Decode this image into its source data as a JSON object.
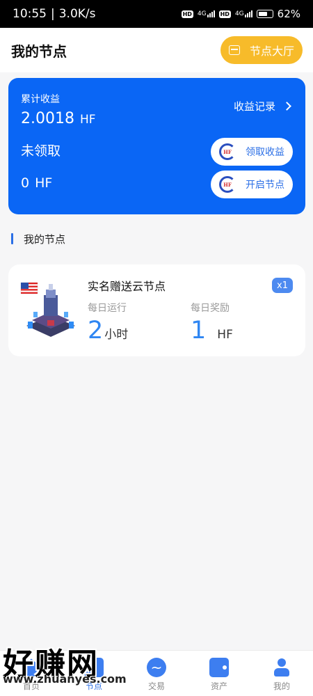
{
  "status_bar": {
    "time": "10:55",
    "speed": "3.0K/s",
    "hd1": "HD",
    "net1": "4G",
    "hd2": "HD",
    "net2": "4G",
    "battery": "62%"
  },
  "header": {
    "title": "我的节点",
    "hall_button": "节点大厅",
    "hall_icon": "store-icon"
  },
  "earnings": {
    "total_label": "累计收益",
    "total_value": "2.0018",
    "total_unit": "HF",
    "record_link": "收益记录",
    "unclaimed_label": "未领取",
    "unclaimed_value": "0",
    "unclaimed_unit": "HF",
    "claim_button": "领取收益",
    "open_node_button": "开启节点",
    "logo_text": "HF"
  },
  "section": {
    "title": "我的节点"
  },
  "node_card": {
    "name": "实名赠送云节点",
    "count_badge": "x1",
    "daily_run_label": "每日运行",
    "daily_run_value": "2",
    "daily_run_unit": "小时",
    "daily_reward_label": "每日奖励",
    "daily_reward_value": "1",
    "daily_reward_unit": "HF"
  },
  "tabs": [
    {
      "label": "首页",
      "icon": "home-icon"
    },
    {
      "label": "节点",
      "icon": "node-icon"
    },
    {
      "label": "交易",
      "icon": "trade-icon"
    },
    {
      "label": "资产",
      "icon": "wallet-icon"
    },
    {
      "label": "我的",
      "icon": "user-icon"
    }
  ],
  "watermark": {
    "main": "好赚网",
    "sub": "www.zhuanyes.com"
  },
  "colors": {
    "primary": "#0a66f5",
    "accent_yellow": "#f7bb2a",
    "metric_blue": "#2f86f2"
  }
}
